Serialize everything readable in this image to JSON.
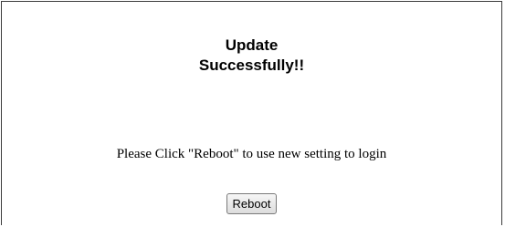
{
  "dialog": {
    "title_line1": "Update",
    "title_line2": "Successfully!!",
    "message": "Please Click \"Reboot\" to use new setting to login",
    "reboot_label": "Reboot"
  }
}
